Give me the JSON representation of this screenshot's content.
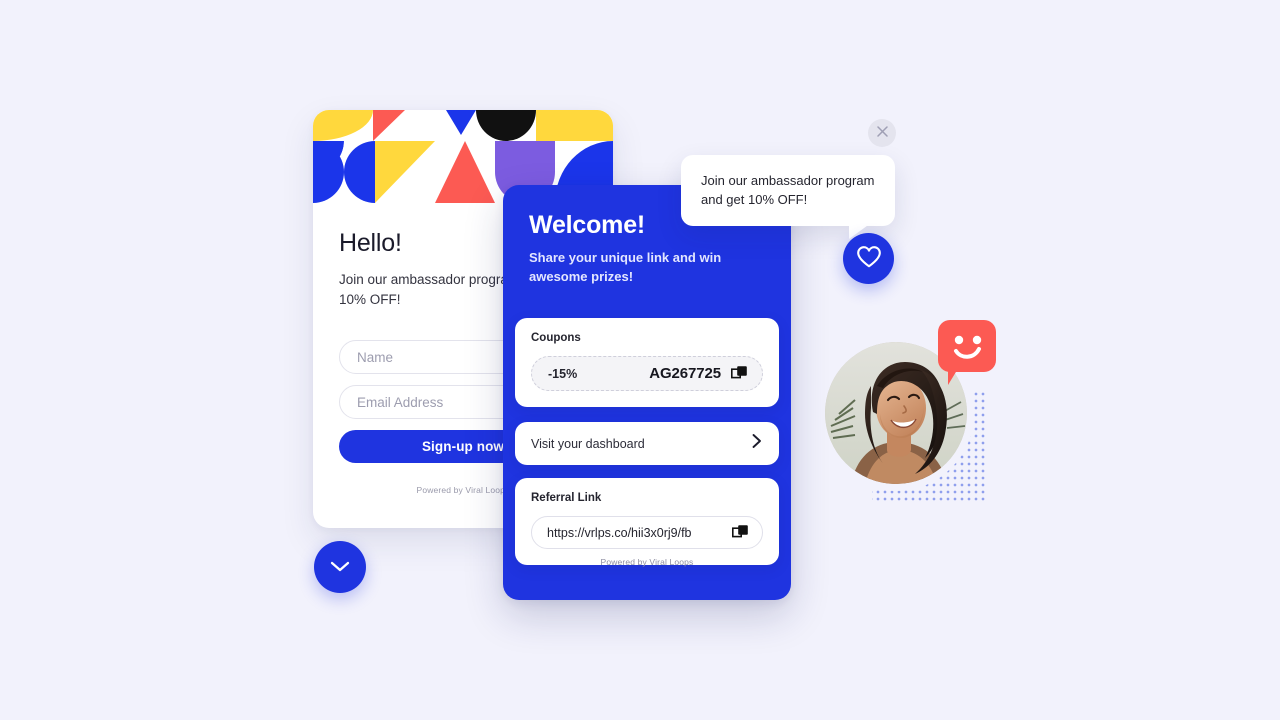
{
  "page": {
    "background_color": "#f2f2fc",
    "brand_blue": "#1f34e0",
    "accent_red": "#fc5a53",
    "accent_yellow": "#ffd83d",
    "accent_purple": "#7c5ce0",
    "accent_black": "#111111"
  },
  "signup_card": {
    "title": "Hello!",
    "subtitle": "Join our ambassador program and get 10% OFF!",
    "name_placeholder": "Name",
    "name_value": "",
    "email_placeholder": "Email Address",
    "email_value": "",
    "submit_label": "Sign-up now",
    "footer": "Powered by Viral Loops"
  },
  "welcome_card": {
    "title": "Welcome!",
    "subtitle": "Share your unique link and win awesome prizes!",
    "coupons_label": "Coupons",
    "coupon": {
      "discount": "-15%",
      "code": "AG267725",
      "copy_icon": "copy-icon"
    },
    "dashboard_link": "Visit your dashboard",
    "dashboard_chevron": "chevron-right-icon",
    "referral_label": "Referral Link",
    "referral_url": "https://vrlps.co/hii3x0rj9/fb",
    "referral_copy_icon": "copy-icon",
    "footer": "Powered by Viral Loops"
  },
  "tooltip": {
    "text": "Join our ambassador program and get 10% OFF!"
  },
  "widgets": {
    "close_icon": "close-icon",
    "heart_icon": "heart-icon",
    "chevron_down_icon": "chevron-down-icon",
    "avatar_icon": "avatar-photo",
    "chat_badge_icon": "smiley-chat-icon"
  }
}
